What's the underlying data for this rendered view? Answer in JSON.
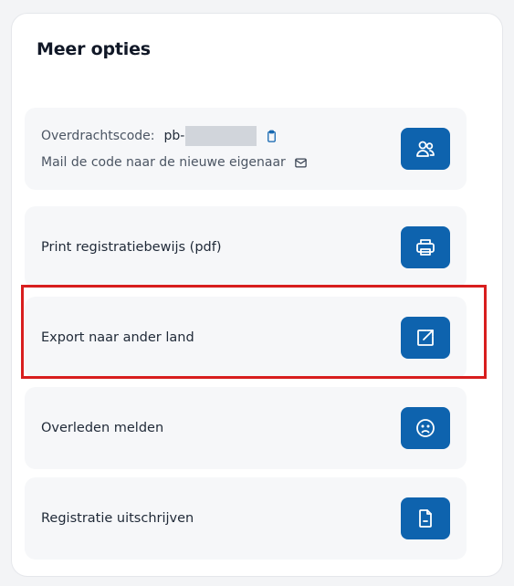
{
  "panel": {
    "title": "Meer opties"
  },
  "transfer": {
    "code_label": "Overdrachtscode:",
    "code_prefix": "pb-",
    "mail_label": "Mail de code naar de nieuwe eigenaar",
    "copy_icon": "clipboard-icon",
    "mail_icon": "envelope-icon",
    "button_icon": "users-icon"
  },
  "options": [
    {
      "label": "Print registratiebewijs (pdf)",
      "icon": "printer-icon"
    },
    {
      "label": "Export naar ander land",
      "icon": "external-link-icon"
    },
    {
      "label": "Overleden melden",
      "icon": "sad-face-icon"
    },
    {
      "label": "Registratie uitschrijven",
      "icon": "document-minus-icon"
    }
  ],
  "colors": {
    "accent": "#0e63ae",
    "highlight": "#d81e1e",
    "row_bg": "#f6f7f9"
  }
}
